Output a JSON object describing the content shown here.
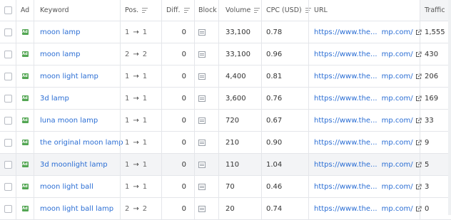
{
  "columns": {
    "ad": "Ad",
    "keyword": "Keyword",
    "pos": "Pos.",
    "diff": "Diff.",
    "block": "Block",
    "volume": "Volume",
    "cpc": "CPC (USD)",
    "url": "URL",
    "traffic": "Traffic"
  },
  "icons": {
    "sort": "sort-lines-icon",
    "ad": "ad-badge-icon",
    "block": "block-snippet-icon",
    "external": "external-link-icon"
  },
  "colors": {
    "link": "#2b6ed4",
    "ad_badge": "#53a653",
    "highlight_row": "#f3f4f6"
  },
  "rows": [
    {
      "ad_badge": "Ad",
      "keyword": "moon lamp",
      "pos_from": "1",
      "arrow": "→",
      "pos_to": "1",
      "diff": "0",
      "volume": "33,100",
      "cpc": "0.78",
      "url_start": "https://www.the...",
      "url_end": "mp.com/",
      "traffic": "1,555"
    },
    {
      "ad_badge": "Ad",
      "keyword": "moon lamp",
      "pos_from": "2",
      "arrow": "→",
      "pos_to": "2",
      "diff": "0",
      "volume": "33,100",
      "cpc": "0.96",
      "url_start": "https://www.the...",
      "url_end": "mp.com/",
      "traffic": "430"
    },
    {
      "ad_badge": "Ad",
      "keyword": "moon light lamp",
      "pos_from": "1",
      "arrow": "→",
      "pos_to": "1",
      "diff": "0",
      "volume": "4,400",
      "cpc": "0.81",
      "url_start": "https://www.the...",
      "url_end": "mp.com/",
      "traffic": "206"
    },
    {
      "ad_badge": "Ad",
      "keyword": "3d lamp",
      "pos_from": "1",
      "arrow": "→",
      "pos_to": "1",
      "diff": "0",
      "volume": "3,600",
      "cpc": "0.76",
      "url_start": "https://www.the...",
      "url_end": "mp.com/",
      "traffic": "169"
    },
    {
      "ad_badge": "Ad",
      "keyword": "luna moon lamp",
      "pos_from": "1",
      "arrow": "→",
      "pos_to": "1",
      "diff": "0",
      "volume": "720",
      "cpc": "0.67",
      "url_start": "https://www.the...",
      "url_end": "mp.com/",
      "traffic": "33"
    },
    {
      "ad_badge": "Ad",
      "keyword": "the original moon lamp",
      "pos_from": "1",
      "arrow": "→",
      "pos_to": "1",
      "diff": "0",
      "volume": "210",
      "cpc": "0.90",
      "url_start": "https://www.the...",
      "url_end": "mp.com/",
      "traffic": "9"
    },
    {
      "ad_badge": "Ad",
      "keyword": "3d moonlight lamp",
      "pos_from": "1",
      "arrow": "→",
      "pos_to": "1",
      "diff": "0",
      "volume": "110",
      "cpc": "1.04",
      "url_start": "https://www.the...",
      "url_end": "mp.com/",
      "traffic": "5"
    },
    {
      "ad_badge": "Ad",
      "keyword": "moon light ball",
      "pos_from": "1",
      "arrow": "→",
      "pos_to": "1",
      "diff": "0",
      "volume": "70",
      "cpc": "0.46",
      "url_start": "https://www.the...",
      "url_end": "mp.com/",
      "traffic": "3"
    },
    {
      "ad_badge": "Ad",
      "keyword": "moon light ball lamp",
      "pos_from": "2",
      "arrow": "→",
      "pos_to": "2",
      "diff": "0",
      "volume": "20",
      "cpc": "0.74",
      "url_start": "https://www.the...",
      "url_end": "mp.com/",
      "traffic": "0"
    }
  ]
}
